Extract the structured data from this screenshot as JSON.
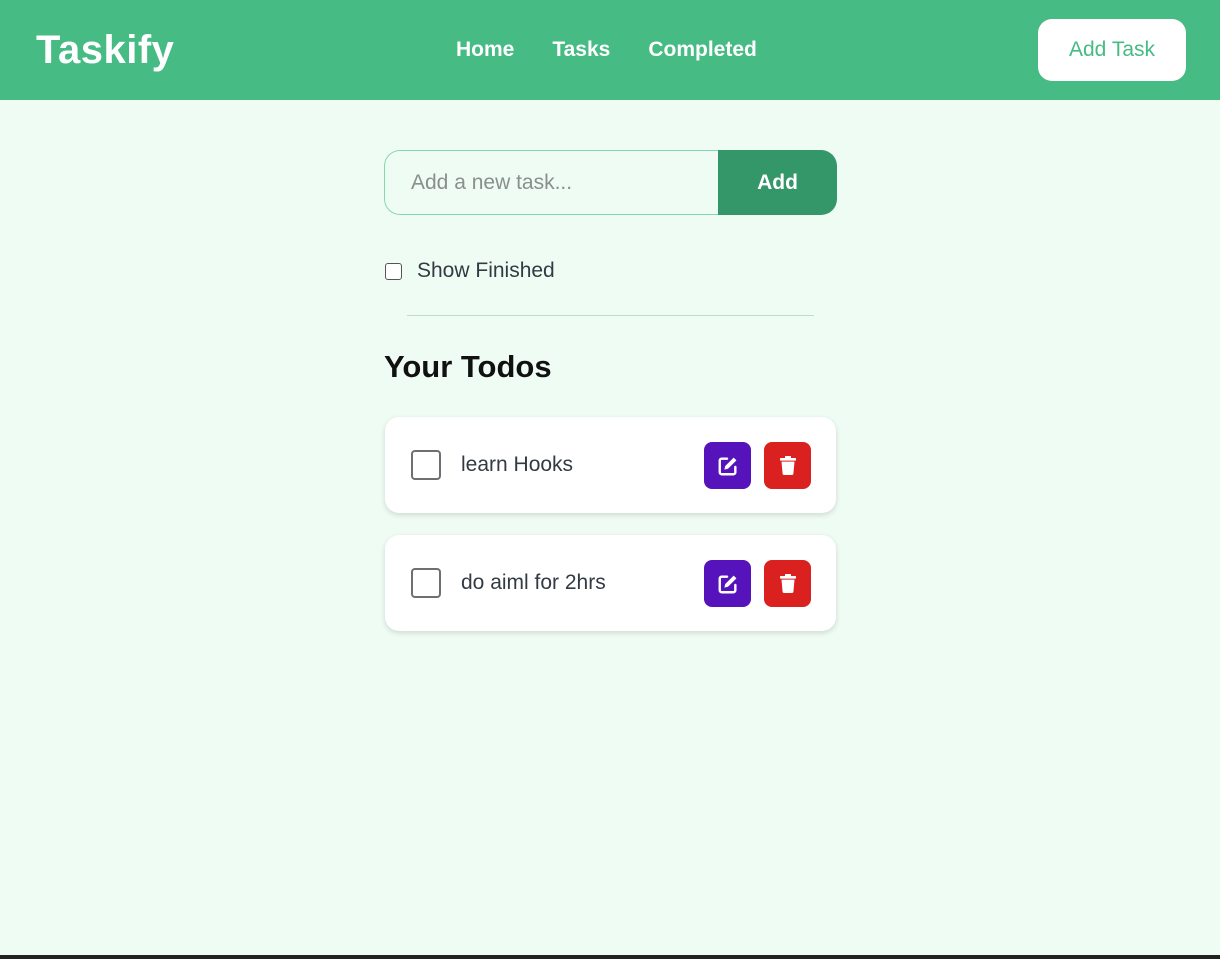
{
  "header": {
    "brand": "Taskify",
    "nav": [
      "Home",
      "Tasks",
      "Completed"
    ],
    "add_task_label": "Add Task"
  },
  "form": {
    "placeholder": "Add a new task...",
    "value": "",
    "add_label": "Add",
    "show_finished_label": "Show Finished",
    "show_finished_checked": false
  },
  "todos_section": {
    "title": "Your Todos",
    "items": [
      {
        "text": "learn Hooks",
        "done": false
      },
      {
        "text": "do aiml for 2hrs",
        "done": false
      }
    ]
  },
  "icons": {
    "edit": "edit-icon",
    "delete": "trash-icon"
  },
  "colors": {
    "brand_green": "#46bb83",
    "button_green": "#33976a",
    "edit_purple": "#5713bb",
    "delete_red": "#db2020",
    "page_bg": "#effcf3"
  }
}
